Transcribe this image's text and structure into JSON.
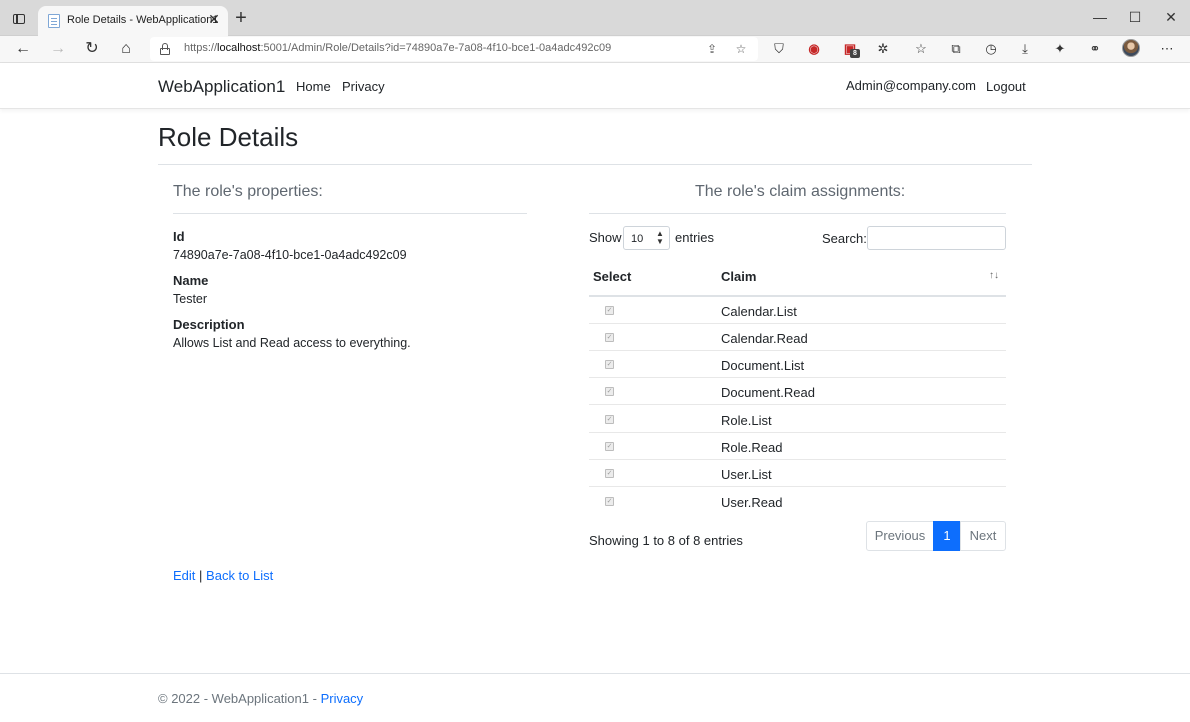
{
  "browser": {
    "tab_title": "Role Details - WebApplication1",
    "url_prefix": "https://",
    "url_host": "localhost",
    "url_rest": ":5001/Admin/Role/Details?id=74890a7e-7a08-4f10-bce1-0a4adc492c09",
    "extension_badge": "8",
    "icons": [
      "tab-actions-icon",
      "close-icon",
      "plus-icon",
      "minimize-icon",
      "maximize-icon",
      "close-window-icon",
      "back-arrow-icon",
      "forward-arrow-icon",
      "reload-icon",
      "home-icon",
      "lock-icon",
      "share-icon",
      "favorite-add-icon",
      "shield-icon",
      "ublock-icon",
      "extension-icon",
      "puzzle-icon",
      "favorites-icon",
      "collections-icon",
      "history-icon",
      "download-icon",
      "copilot-icon",
      "sidebar-icon",
      "profile-avatar",
      "more-icon"
    ]
  },
  "navbar": {
    "brand": "WebApplication1",
    "links": [
      "Home",
      "Privacy"
    ],
    "user": "Admin@company.com",
    "logout": "Logout"
  },
  "page": {
    "title": "Role Details",
    "properties_heading": "The role's properties:",
    "claims_heading": "The role's claim assignments:",
    "fields": [
      {
        "label": "Id",
        "value": "74890a7e-7a08-4f10-bce1-0a4adc492c09"
      },
      {
        "label": "Name",
        "value": "Tester"
      },
      {
        "label": "Description",
        "value": "Allows List and Read access to everything."
      }
    ]
  },
  "table": {
    "length_label_pre": "Show",
    "length_value": "10",
    "length_label_post": "entries",
    "search_label": "Search:",
    "search_value": "",
    "columns": [
      "Select",
      "Claim"
    ],
    "rows": [
      {
        "checked": true,
        "claim": "Calendar.List"
      },
      {
        "checked": true,
        "claim": "Calendar.Read"
      },
      {
        "checked": true,
        "claim": "Document.List"
      },
      {
        "checked": true,
        "claim": "Document.Read"
      },
      {
        "checked": true,
        "claim": "Role.List"
      },
      {
        "checked": true,
        "claim": "Role.Read"
      },
      {
        "checked": true,
        "claim": "User.List"
      },
      {
        "checked": true,
        "claim": "User.Read"
      }
    ],
    "info": "Showing 1 to 8 of 8 entries",
    "pager": {
      "previous": "Previous",
      "page": "1",
      "next": "Next"
    }
  },
  "actions": {
    "edit": "Edit",
    "separator": "|",
    "back": "Back to List"
  },
  "footer": {
    "text": "© 2022 - WebApplication1 -",
    "link": "Privacy"
  },
  "colors": {
    "link": "#0d6efd",
    "active_page": "#0d6efd",
    "heading_muted": "#5f6770"
  }
}
